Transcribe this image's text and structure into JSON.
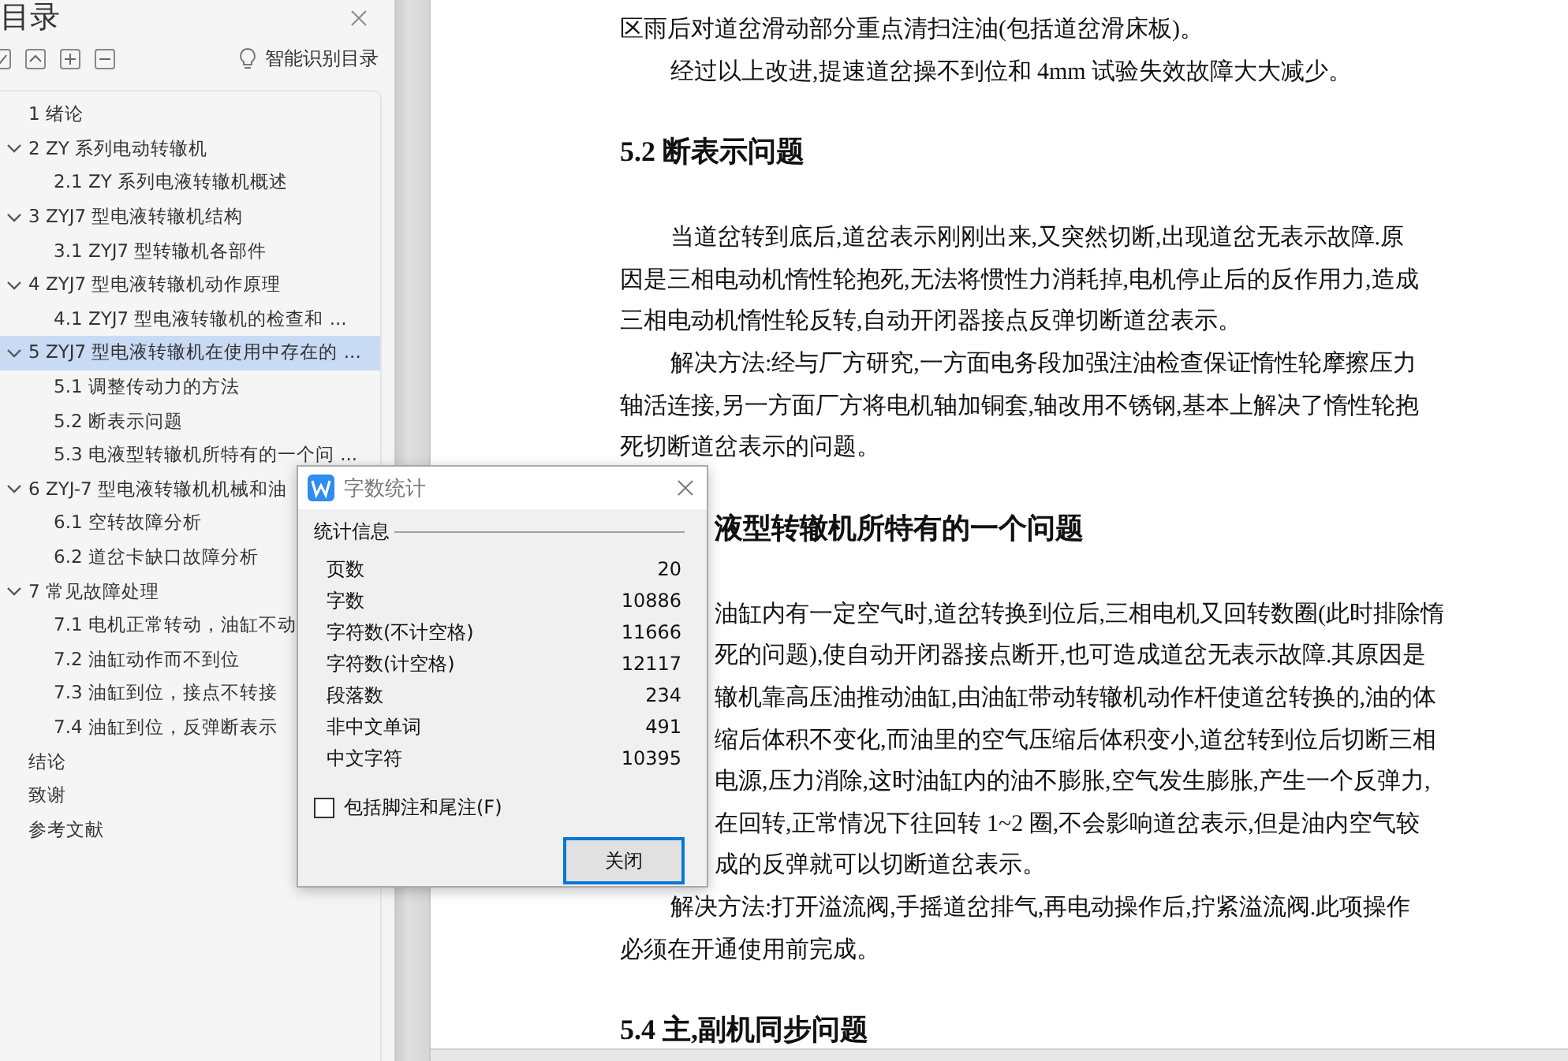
{
  "sidebar": {
    "title": "目录",
    "smart_toc": "智能识别目录",
    "items": [
      {
        "label": "1  绪论",
        "selected": false
      },
      {
        "label": "2 ZY 系列电动转辙机",
        "selected": false,
        "expanded": true,
        "children": [
          {
            "label": "2.1 ZY 系列电液转辙机概述",
            "selected": false
          }
        ]
      },
      {
        "label": "3 ZYJ7 型电液转辙机结构",
        "selected": false,
        "expanded": true,
        "children": [
          {
            "label": "3.1 ZYJ7 型转辙机各部件",
            "selected": false
          }
        ]
      },
      {
        "label": "4 ZYJ7 型电液转辙机动作原理",
        "selected": false,
        "expanded": true,
        "children": [
          {
            "label": "4.1 ZYJ7 型电液转辙机的检查和 ...",
            "selected": false
          }
        ]
      },
      {
        "label": "5 ZYJ7 型电液转辙机在使用中存在的 ...",
        "selected": true,
        "expanded": true,
        "children": [
          {
            "label": "5.1  调整传动力的方法",
            "selected": false
          },
          {
            "label": "5.2  断表示问题",
            "selected": false
          },
          {
            "label": "5.3  电液型转辙机所特有的一个问 ...",
            "selected": false
          }
        ]
      },
      {
        "label": "6 ZYJ-7 型电液转辙机机械和油",
        "selected": false,
        "expanded": true,
        "children": [
          {
            "label": "6.1 空转故障分析",
            "selected": false
          },
          {
            "label": "6.2 道岔卡缺口故障分析",
            "selected": false
          }
        ]
      },
      {
        "label": "7  常见故障处理",
        "selected": false,
        "expanded": true,
        "children": [
          {
            "label": "7.1 电机正常转动，油缸不动",
            "selected": false
          },
          {
            "label": "7.2  油缸动作而不到位",
            "selected": false
          },
          {
            "label": "7.3  油缸到位，接点不转接",
            "selected": false
          },
          {
            "label": "7.4  油缸到位，反弹断表示",
            "selected": false
          }
        ]
      },
      {
        "label": "结论",
        "selected": false
      },
      {
        "label": "致谢",
        "selected": false
      },
      {
        "label": "参考文献",
        "selected": false
      }
    ]
  },
  "document": {
    "blocks": [
      {
        "kind": "paragraph",
        "lines": [
          {
            "text": "区雨后对道岔滑动部分重点清扫注油(包括道岔滑床板)。"
          }
        ]
      },
      {
        "kind": "paragraph",
        "lines": [
          {
            "text": "经过以上改进,提速道岔操不到位和 4mm 试验失效故障大大减少。",
            "indent": true
          }
        ]
      },
      {
        "kind": "heading",
        "lines": [
          {
            "text": "5.2 断表示问题"
          }
        ]
      },
      {
        "kind": "paragraph",
        "lines": [
          {
            "text": "当道岔转到底后,道岔表示刚刚出来,又突然切断,出现道岔无表示故障.原",
            "indent": true
          },
          {
            "text": "因是三相电动机惰性轮抱死,无法将惯性力消耗掉,电机停止后的反作用力,造成"
          },
          {
            "text": "三相电动机惰性轮反转,自动开闭器接点反弹切断道岔表示。"
          }
        ]
      },
      {
        "kind": "paragraph",
        "lines": [
          {
            "text": "解决方法:经与厂方研究,一方面电务段加强注油检查保证惰性轮摩擦压力",
            "indent": true
          },
          {
            "text": "轴活连接,另一方面厂方将电机轴加铜套,轴改用不锈钢,基本上解决了惰性轮抱"
          },
          {
            "text": "死切断道岔表示的问题。"
          }
        ]
      },
      {
        "kind": "heading",
        "lines": [
          {
            "text": "液型转辙机所特有的一个问题",
            "covered": true
          }
        ]
      },
      {
        "kind": "paragraph",
        "lines": [
          {
            "text": "油缸内有一定空气时,道岔转换到位后,三相电机又回转数圈(此时排除惰",
            "covered": true
          },
          {
            "text": "死的问题),使自动开闭器接点断开,也可造成道岔无表示故障.其原因是",
            "covered": true
          },
          {
            "text": "辙机靠高压油推动油缸,由油缸带动转辙机动作杆使道岔转换的,油的体",
            "covered": true
          },
          {
            "text": "缩后体积不变化,而油里的空气压缩后体积变小,道岔转到位后切断三相",
            "covered": true
          },
          {
            "text": "电源,压力消除,这时油缸内的油不膨胀,空气发生膨胀,产生一个反弹力,",
            "covered": true
          },
          {
            "text": "在回转,正常情况下往回转 1~2 圈,不会影响道岔表示,但是油内空气较",
            "covered": true
          },
          {
            "text": "成的反弹就可以切断道岔表示。",
            "covered": true
          }
        ]
      },
      {
        "kind": "paragraph",
        "lines": [
          {
            "text": "解决方法:打开溢流阀,手摇道岔排气,再电动操作后,拧紧溢流阀.此项操作",
            "indent": true
          },
          {
            "text": "必须在开通使用前完成。"
          }
        ]
      },
      {
        "kind": "heading",
        "lines": [
          {
            "text": "5.4 主,副机同步问题"
          }
        ]
      }
    ]
  },
  "dialog": {
    "title": "字数统计",
    "group": "统计信息",
    "stats": [
      {
        "label": "页数",
        "value": "20"
      },
      {
        "label": "字数",
        "value": "10886"
      },
      {
        "label": "字符数(不计空格)",
        "value": "11666"
      },
      {
        "label": "字符数(计空格)",
        "value": "12117"
      },
      {
        "label": "段落数",
        "value": "234"
      },
      {
        "label": "非中文单词",
        "value": "491"
      },
      {
        "label": "中文字符",
        "value": "10395"
      }
    ],
    "checkbox": {
      "label": "包括脚注和尾注(F)",
      "checked": false
    },
    "button": "关闭"
  }
}
